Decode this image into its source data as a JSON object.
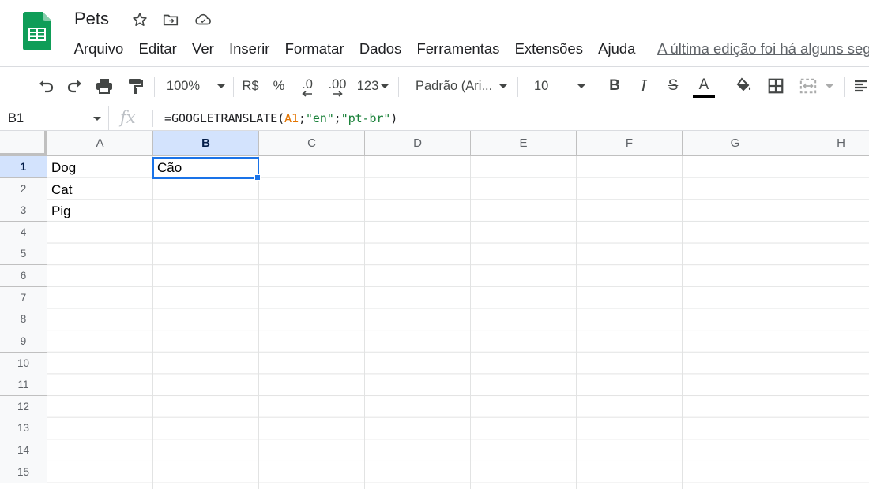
{
  "app": {
    "doc_title": "Pets",
    "menu": [
      "Arquivo",
      "Editar",
      "Ver",
      "Inserir",
      "Formatar",
      "Dados",
      "Ferramentas",
      "Extensões",
      "Ajuda"
    ],
    "last_edit": "A última edição foi há alguns segundos"
  },
  "toolbar": {
    "zoom": "100%",
    "currency": "R$",
    "percent": "%",
    "decrease_decimals": ".0",
    "increase_decimals": ".00",
    "more_formats": "123",
    "font": "Padrão (Ari...",
    "font_size": "10",
    "bold": "B",
    "italic": "I",
    "strikethrough": "S",
    "text_color_letter": "A",
    "text_color": "#000000"
  },
  "formula_bar": {
    "name_box": "B1",
    "fx": "fx",
    "formula_parts": [
      {
        "text": "=GOOGLETRANSLATE(",
        "kind": "plain"
      },
      {
        "text": "A1",
        "kind": "ref"
      },
      {
        "text": ";",
        "kind": "plain"
      },
      {
        "text": "\"en\"",
        "kind": "str"
      },
      {
        "text": ";",
        "kind": "plain"
      },
      {
        "text": "\"pt-br\"",
        "kind": "str"
      },
      {
        "text": ")",
        "kind": "plain"
      }
    ]
  },
  "sheet": {
    "columns": [
      "A",
      "B",
      "C",
      "D",
      "E",
      "F",
      "G",
      "H"
    ],
    "rows": [
      "1",
      "2",
      "3",
      "4",
      "5",
      "6",
      "7",
      "8",
      "9",
      "10",
      "11",
      "12",
      "13",
      "14",
      "15"
    ],
    "active_cell": "B1",
    "cells": {
      "A1": "Dog",
      "B1": "Cão",
      "A2": "Cat",
      "A3": "Pig"
    }
  },
  "colors": {
    "accent": "#1a73e8",
    "logo_green": "#0f9d58",
    "ref_orange": "#e37400",
    "string_green": "#188038"
  }
}
